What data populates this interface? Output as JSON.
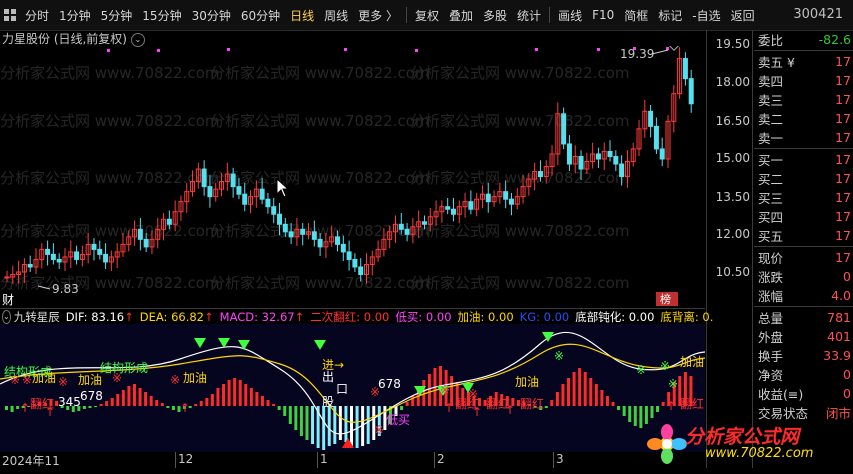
{
  "toolbar": {
    "items": [
      "分时",
      "1分钟",
      "5分钟",
      "15分钟",
      "30分钟",
      "60分钟",
      "日线",
      "周线",
      "更多 〉",
      "复权",
      "叠加",
      "多股",
      "统计",
      "画线",
      "F10",
      "简框",
      "标记",
      "-自选",
      "返回"
    ],
    "active_index": 6,
    "stock_code": "300421"
  },
  "chart_title": "力星股份 (日线,前复权)",
  "price_axis": [
    "19.50",
    "18.00",
    "16.50",
    "15.00",
    "13.50",
    "12.00",
    "10.50"
  ],
  "annotations": {
    "high_label": "19.39",
    "low_label": "9.83",
    "cai_label": "财",
    "bang_label": "榜"
  },
  "watermark_text": "分析家公式网 www.70822.com",
  "indicator": {
    "name": "九转星辰",
    "items": [
      {
        "label": "DIF: 83.16",
        "arrow": "↑",
        "color": "#ffffff"
      },
      {
        "label": "DEA: 66.82",
        "arrow": "↑",
        "color": "#ffd700"
      },
      {
        "label": "MACD: 32.67",
        "arrow": "↑",
        "color": "#ff44ff"
      },
      {
        "label": "二次翻红: 0.00",
        "arrow": "",
        "color": "#ff3030"
      },
      {
        "label": "低买: 0.00",
        "arrow": "",
        "color": "#ff44ff"
      },
      {
        "label": "加油: 0.00",
        "arrow": "",
        "color": "#ffd700"
      },
      {
        "label": "KG: 0.00",
        "arrow": "",
        "color": "#2050ff"
      },
      {
        "label": "底部钝化: 0.00",
        "arrow": "",
        "color": "#ffffff"
      },
      {
        "label": "底背离: 0.",
        "arrow": "",
        "color": "#ffd700"
      }
    ]
  },
  "indicator_labels": {
    "jiegou_1": "结构形成",
    "jiegou_2": "结构形成",
    "jiayou": "加油",
    "fanhong": "翻红",
    "dimai": "低买",
    "jin": "进",
    "chu": "出",
    "kou": "口",
    "gu": "股",
    "shuzi_1": "345",
    "shuzi_2": "678",
    "shuzi_3": "678"
  },
  "dates": [
    "2024年11",
    "12",
    "1",
    "2",
    "3"
  ],
  "right_panel": [
    {
      "label": "委比",
      "value": "-82.6",
      "color": "green"
    },
    {
      "label": "卖五 ¥",
      "value": "17"
    },
    {
      "label": "卖四",
      "value": "17"
    },
    {
      "label": "卖三",
      "value": "17"
    },
    {
      "label": "卖二",
      "value": "17"
    },
    {
      "label": "卖一",
      "value": "17"
    },
    {
      "label": "买一",
      "value": "17"
    },
    {
      "label": "买二",
      "value": "17"
    },
    {
      "label": "买三",
      "value": "17"
    },
    {
      "label": "买四",
      "value": "17"
    },
    {
      "label": "买五",
      "value": "17"
    },
    {
      "label": "现价",
      "value": "17"
    },
    {
      "label": "涨跌",
      "value": "0"
    },
    {
      "label": "涨幅",
      "value": "4.0"
    },
    {
      "label": "总量",
      "value": "781"
    },
    {
      "label": "外盘",
      "value": "401"
    },
    {
      "label": "换手",
      "value": "33.9"
    },
    {
      "label": "净资",
      "value": "0"
    },
    {
      "label": "收益(≡)",
      "value": "0"
    },
    {
      "label": "交易状态",
      "value": "闭市"
    }
  ],
  "logo": {
    "title": "分析家公式网",
    "url": "www.70822.com"
  }
}
